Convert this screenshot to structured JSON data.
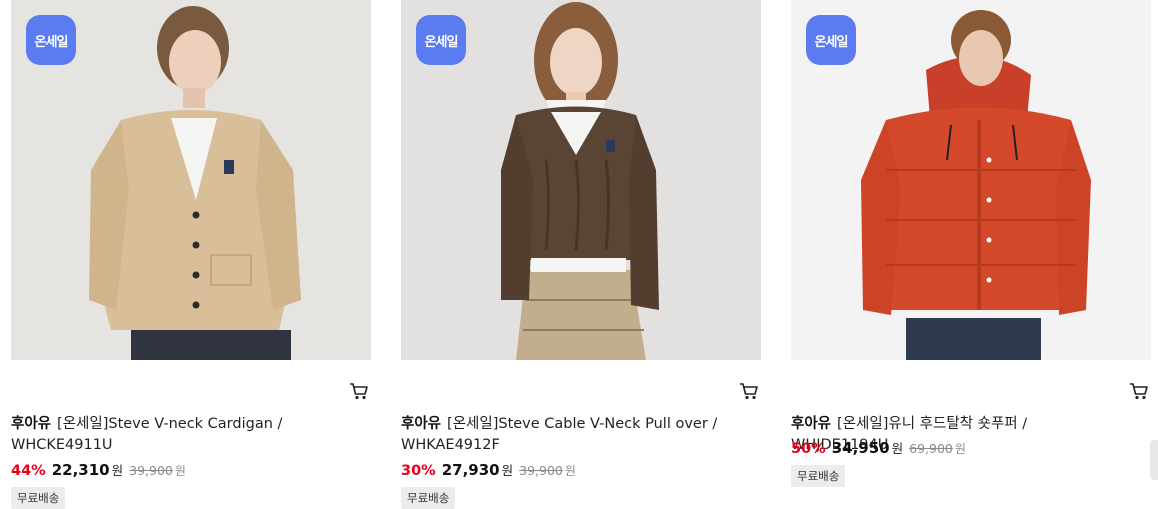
{
  "products": [
    {
      "badge": "온세일",
      "brand": "후아유",
      "name": "[온세일]Steve V-neck Cardigan / WHCKE4911U",
      "discount": "44%",
      "price": "22,310",
      "price_unit": "원",
      "original_price": "39,900",
      "original_unit": "원",
      "shipping": "무료배송",
      "image_desc": "cardigan-model-image",
      "colors": {
        "bg": "#e6e4e1",
        "garment": "#d9bf99",
        "pants": "#2f3440"
      }
    },
    {
      "badge": "온세일",
      "brand": "후아유",
      "name": "[온세일]Steve Cable V-Neck Pull over / WHKAE4912F",
      "discount": "30%",
      "price": "27,930",
      "price_unit": "원",
      "original_price": "39,900",
      "original_unit": "원",
      "shipping": "무료배송",
      "image_desc": "pullover-model-image",
      "colors": {
        "bg": "#e3e1df",
        "garment": "#5a4434",
        "skirt": "#c2ad8c"
      }
    },
    {
      "badge": "온세일",
      "brand": "후아유",
      "name": "[온세일]유니 후드탈착 숏푸퍼 / WHJDE1194U",
      "discount": "50%",
      "price": "34,950",
      "price_unit": "원",
      "original_price": "69,900",
      "original_unit": "원",
      "shipping": "무료배송",
      "image_desc": "puffer-model-image",
      "colors": {
        "bg": "#f3f3f3",
        "garment": "#d4492a",
        "pants": "#2e3a4e"
      }
    }
  ],
  "theme": {
    "badge_color": "#5a7cf0",
    "discount_color": "#e8001b"
  }
}
